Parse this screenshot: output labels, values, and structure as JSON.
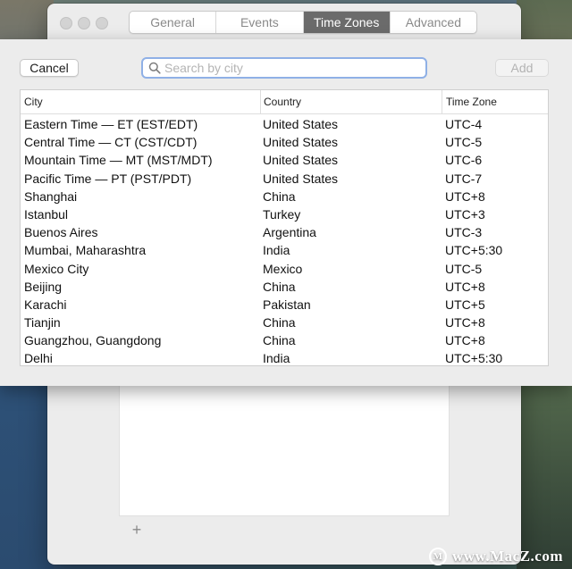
{
  "tabs": [
    {
      "label": "General",
      "active": false
    },
    {
      "label": "Events",
      "active": false
    },
    {
      "label": "Time Zones",
      "active": true
    },
    {
      "label": "Advanced",
      "active": false
    }
  ],
  "sheet": {
    "cancel_label": "Cancel",
    "add_label": "Add",
    "search": {
      "placeholder": "Search by city",
      "value": ""
    }
  },
  "table": {
    "headers": [
      "City",
      "Country",
      "Time Zone"
    ],
    "rows": [
      {
        "city": "Eastern Time — ET (EST/EDT)",
        "country": "United States",
        "tz": "UTC-4"
      },
      {
        "city": "Central Time — CT (CST/CDT)",
        "country": "United States",
        "tz": "UTC-5"
      },
      {
        "city": "Mountain Time — MT (MST/MDT)",
        "country": "United States",
        "tz": "UTC-6"
      },
      {
        "city": "Pacific Time — PT (PST/PDT)",
        "country": "United States",
        "tz": "UTC-7"
      },
      {
        "city": "Shanghai",
        "country": "China",
        "tz": "UTC+8"
      },
      {
        "city": "Istanbul",
        "country": "Turkey",
        "tz": "UTC+3"
      },
      {
        "city": "Buenos Aires",
        "country": "Argentina",
        "tz": "UTC-3"
      },
      {
        "city": "Mumbai, Maharashtra",
        "country": "India",
        "tz": "UTC+5:30"
      },
      {
        "city": "Mexico City",
        "country": "Mexico",
        "tz": "UTC-5"
      },
      {
        "city": "Beijing",
        "country": "China",
        "tz": "UTC+8"
      },
      {
        "city": "Karachi",
        "country": "Pakistan",
        "tz": "UTC+5"
      },
      {
        "city": "Tianjin",
        "country": "China",
        "tz": "UTC+8"
      },
      {
        "city": "Guangzhou, Guangdong",
        "country": "China",
        "tz": "UTC+8"
      },
      {
        "city": "Delhi",
        "country": "India",
        "tz": "UTC+5:30"
      }
    ]
  },
  "back_window": {
    "add_symbol": "+"
  },
  "watermark": {
    "text": "www.MacZ.com"
  },
  "colors": {
    "active_tab": "#6b6b6b",
    "search_focus": "#8fb0e6"
  }
}
